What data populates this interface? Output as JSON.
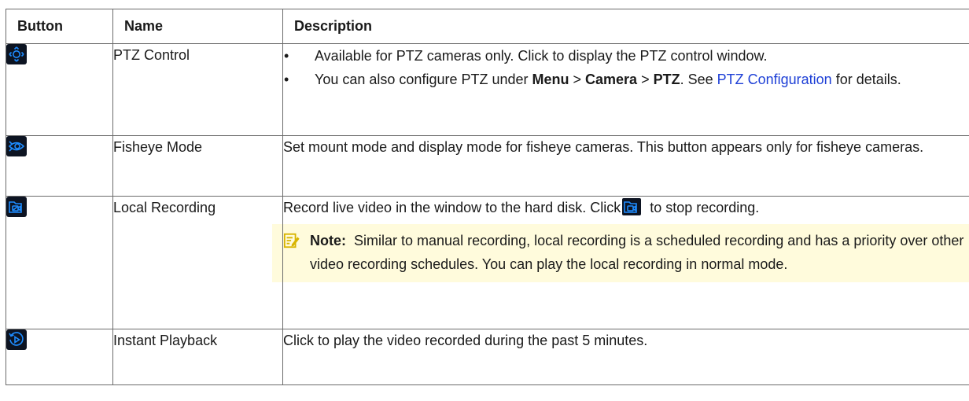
{
  "header": {
    "button": "Button",
    "name": "Name",
    "description": "Description"
  },
  "rows": [
    {
      "icon": "ptz-control-icon",
      "name": "PTZ Control",
      "bullet1": "Available for PTZ cameras only. Click to display the PTZ control window.",
      "bullet2_pre": "You can also configure PTZ under ",
      "menu": "Menu",
      "sep1": " > ",
      "camera": "Camera",
      "sep2": " > ",
      "ptz": "PTZ",
      "bullet2_mid": ". See ",
      "link": "PTZ Configuration",
      "bullet2_post": " for details."
    },
    {
      "icon": "fisheye-mode-icon",
      "name": "Fisheye Mode",
      "description": "Set mount mode and display mode for fisheye cameras. This button appears only for fisheye cameras."
    },
    {
      "icon": "local-recording-icon",
      "name": "Local Recording",
      "desc_pre": "Record live video in the window to the hard disk. Click",
      "desc_post": " to stop recording.",
      "note_label": "Note:",
      "note_text": "Similar to manual recording, local recording is a scheduled recording and has a priority over other video recording schedules. You can play the local recording in normal mode."
    },
    {
      "icon": "instant-playback-icon",
      "name": "Instant Playback",
      "description": "Click to play the video recorded during the past 5 minutes."
    }
  ],
  "colors": {
    "icon_bg": "#0d1422",
    "icon_fg": "#1e8cff",
    "link": "#1d3fd6",
    "note_bg": "#fffbdc",
    "note_icon": "#d8b400"
  }
}
